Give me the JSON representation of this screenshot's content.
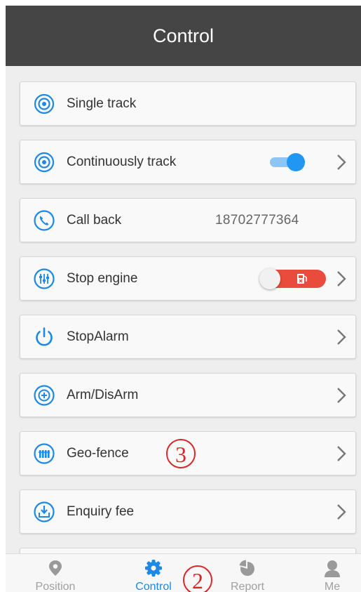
{
  "header": {
    "title": "Control"
  },
  "items": [
    {
      "label": "Single track",
      "icon": "target-icon"
    },
    {
      "label": "Continuously track",
      "icon": "target-icon",
      "toggle": "on"
    },
    {
      "label": "Call back",
      "icon": "phone-icon",
      "value": "18702777364"
    },
    {
      "label": "Stop engine",
      "icon": "sliders-icon",
      "toggle": "engine-on"
    },
    {
      "label": "StopAlarm",
      "icon": "power-icon"
    },
    {
      "label": "Arm/DisArm",
      "icon": "shield-plus-icon"
    },
    {
      "label": "Geo-fence",
      "icon": "fence-icon"
    },
    {
      "label": "Enquiry fee",
      "icon": "coin-download-icon"
    }
  ],
  "annotations": [
    "3",
    "2"
  ],
  "tabbar": {
    "tabs": [
      {
        "label": "Position",
        "icon": "location-pin-icon",
        "active": false
      },
      {
        "label": "Control",
        "icon": "gear-icon",
        "active": true
      },
      {
        "label": "Report",
        "icon": "pie-chart-icon",
        "active": false
      },
      {
        "label": "Me",
        "icon": "user-icon",
        "active": false
      }
    ]
  },
  "colors": {
    "accent": "#1e88e5",
    "header": "#454545",
    "danger": "#e94b3c",
    "annotation": "#d62828"
  }
}
